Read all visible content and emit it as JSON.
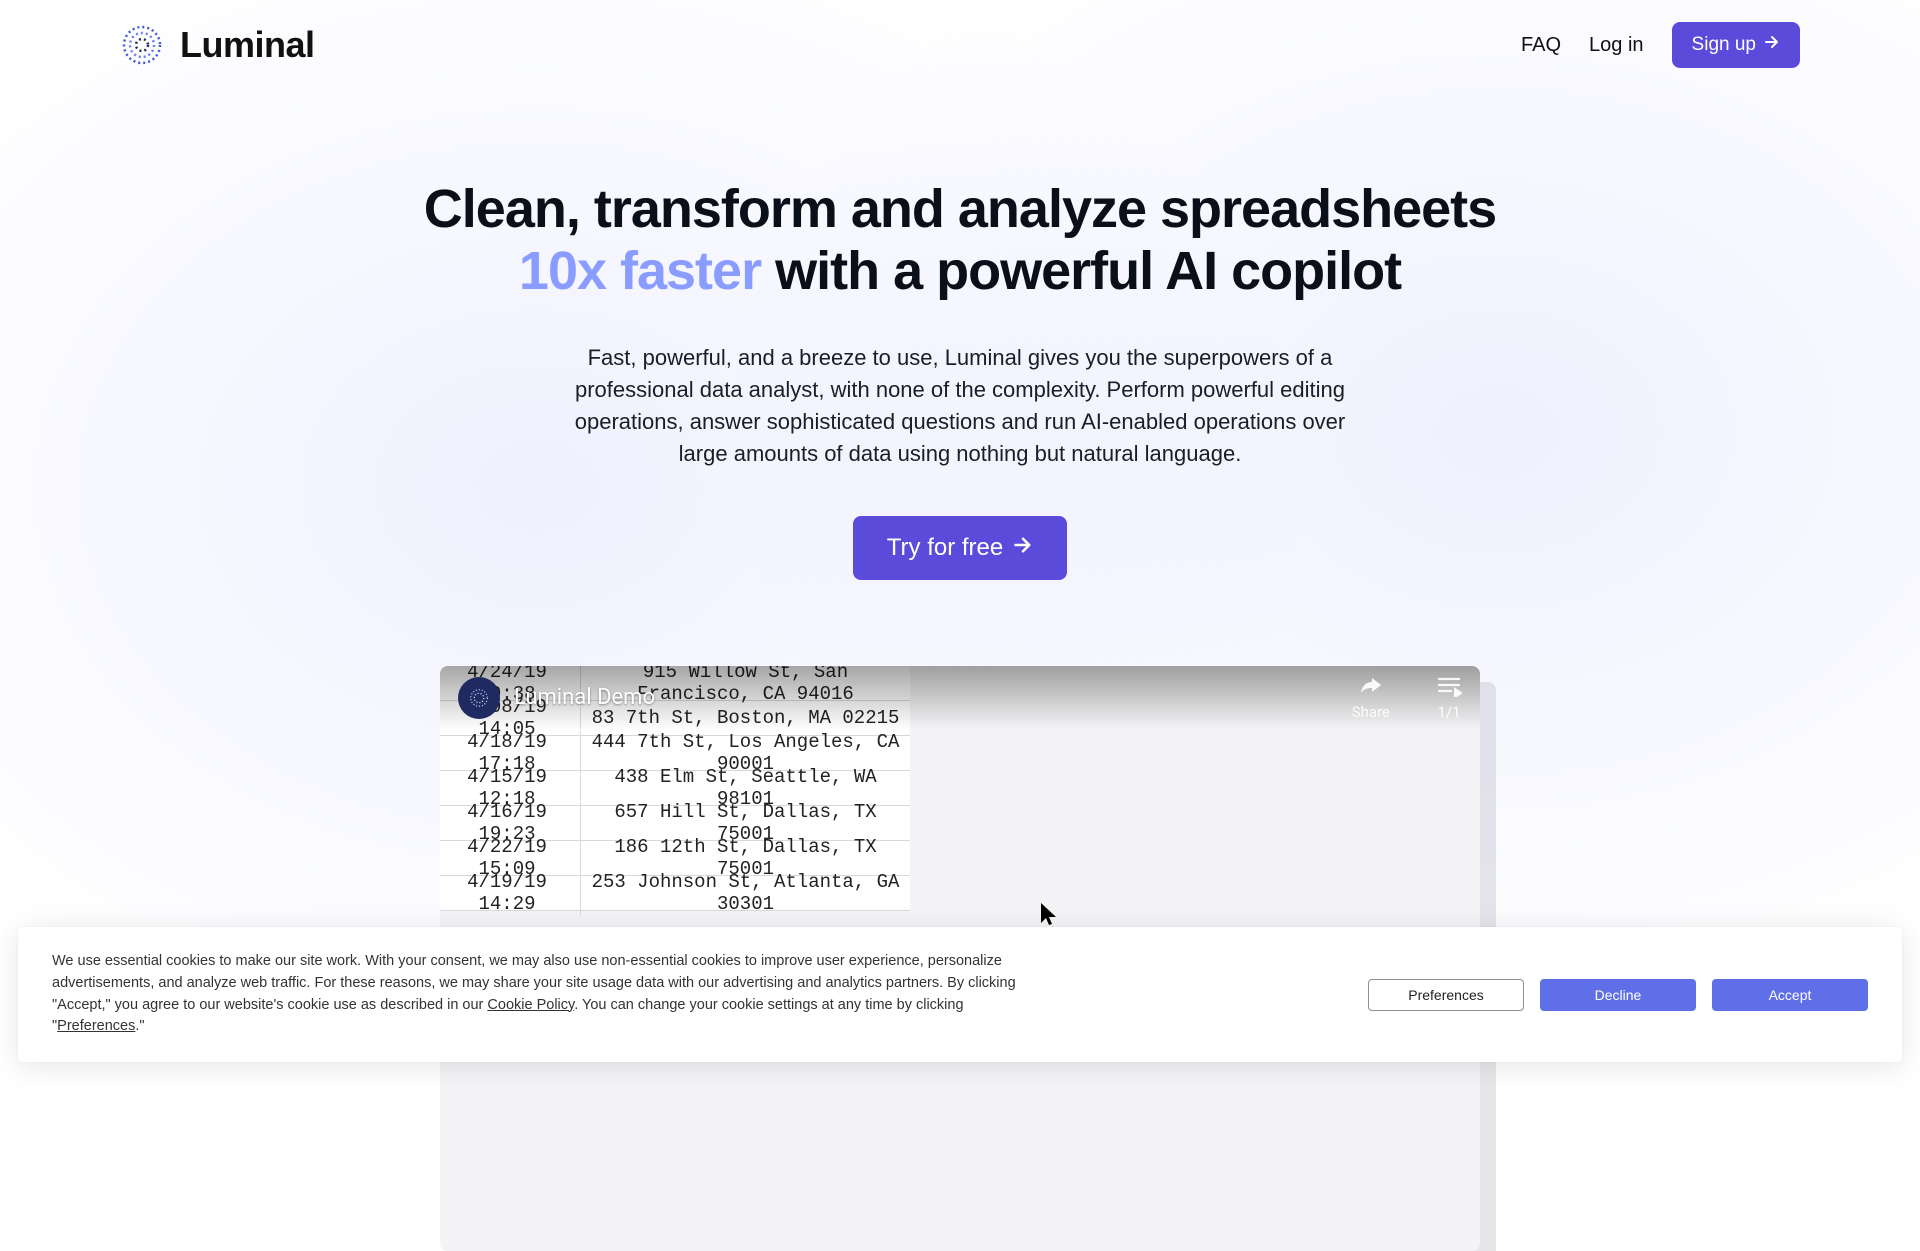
{
  "brand": {
    "name": "Luminal"
  },
  "nav": {
    "faq": "FAQ",
    "login": "Log in",
    "signup": "Sign up"
  },
  "hero": {
    "line1": "Clean, transform and analyze spreadsheets",
    "highlight": "10x faster",
    "line2_rest": " with a powerful AI copilot",
    "subtitle": "Fast, powerful, and a breeze to use, Luminal gives you the superpowers of a professional data analyst, with none of the complexity. Perform powerful editing operations, answer sophisticated questions and run AI-enabled operations over large amounts of data using nothing but natural language.",
    "cta": "Try for free"
  },
  "video": {
    "title": "Luminal Demo",
    "share": "Share",
    "ratio": "1/1",
    "rows": [
      {
        "ts": "4/24/19 10:38",
        "addr": "915 Willow St, San Francisco, CA 94016"
      },
      {
        "ts": "4/08/19 14:05",
        "addr": "83 7th St, Boston, MA 02215"
      },
      {
        "ts": "4/18/19 17:18",
        "addr": "444 7th St, Los Angeles, CA 90001"
      },
      {
        "ts": "4/15/19 12:18",
        "addr": "438 Elm St, Seattle, WA 98101"
      },
      {
        "ts": "4/16/19 19:23",
        "addr": "657 Hill St, Dallas, TX 75001"
      },
      {
        "ts": "4/22/19 15:09",
        "addr": "186 12th St, Dallas, TX 75001"
      },
      {
        "ts": "4/19/19 14:29",
        "addr": "253 Johnson St, Atlanta, GA 30301"
      }
    ]
  },
  "cookies": {
    "text_a": "We use essential cookies to make our site work. With your consent, we may also use non-essential cookies to improve user experience, personalize advertisements, and analyze web traffic. For these reasons, we may share your site usage data with our advertising and analytics partners. By clicking \"Accept,\" you agree to our website's cookie use as described in our ",
    "policy": "Cookie Policy",
    "text_b": ". You can change your cookie settings at any time by clicking \"",
    "pref_word": "Preferences",
    "text_c": ".\"",
    "preferences": "Preferences",
    "decline": "Decline",
    "accept": "Accept"
  }
}
